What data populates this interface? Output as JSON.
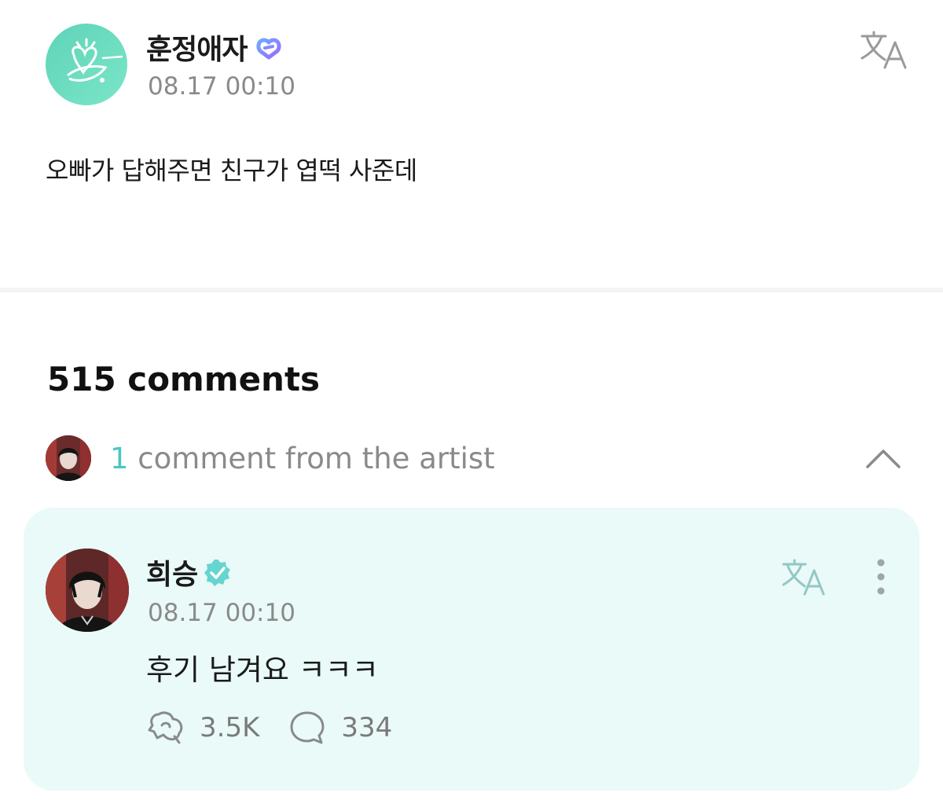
{
  "post": {
    "author": "훈정애자",
    "time": "08.17 00:10",
    "body": "오빠가 답해주면 친구가 엽떡 사준데"
  },
  "comments": {
    "count_label": "515 comments",
    "artist_count": "1",
    "artist_label": " comment from the artist"
  },
  "artist_comment": {
    "name": "희승",
    "time": "08.17 00:10",
    "text": "후기 남겨요 ㅋㅋㅋ",
    "likes": "3.5K",
    "replies": "334"
  },
  "colors": {
    "accent_teal": "#4cc7c0",
    "card_bg": "#e9faf8",
    "muted_text": "#8a8a8a"
  },
  "icons": {
    "translate": "translate-icon",
    "fan_badge": "fan-badge-icon",
    "verified": "verified-badge-icon",
    "chevron": "chevron-up-icon",
    "more": "more-vertical-icon",
    "like": "like-icon",
    "reply": "reply-icon"
  }
}
